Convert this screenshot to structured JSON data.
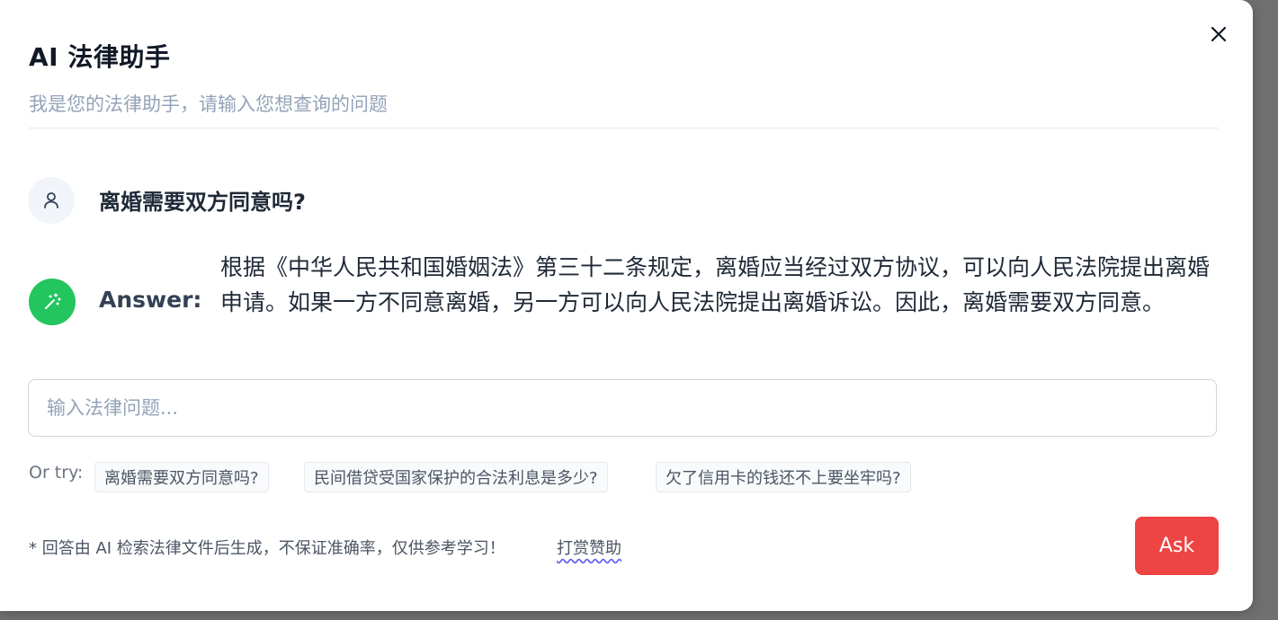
{
  "modal": {
    "title": "AI 法律助手",
    "subtitle": "我是您的法律助手，请输入您想查询的问题"
  },
  "conversation": {
    "question": "离婚需要双方同意吗?",
    "answer_label": "Answer:",
    "answer_text": "根据《中华人民共和国婚姻法》第三十二条规定，离婚应当经过双方协议，可以向人民法院提出离婚申请。如果一方不同意离婚，另一方可以向人民法院提出离婚诉讼。因此，离婚需要双方同意。"
  },
  "input": {
    "placeholder": "输入法律问题...",
    "value": ""
  },
  "suggestions": {
    "label": "Or try:",
    "items": [
      "离婚需要双方同意吗?",
      "民间借贷受国家保护的合法利息是多少?",
      "欠了信用卡的钱还不上要坐牢吗?"
    ]
  },
  "footer": {
    "note": "* 回答由 AI 检索法律文件后生成，不保证准确率，仅供参考学习！",
    "donate_link": "打赏赞助",
    "ask_label": "Ask"
  },
  "icons": {
    "close": "close-icon",
    "user": "user-icon",
    "ai": "magic-wand-icon"
  },
  "colors": {
    "ask_button": "#ef4444",
    "ai_avatar": "#22c55e",
    "user_avatar": "#f1f5f9"
  }
}
